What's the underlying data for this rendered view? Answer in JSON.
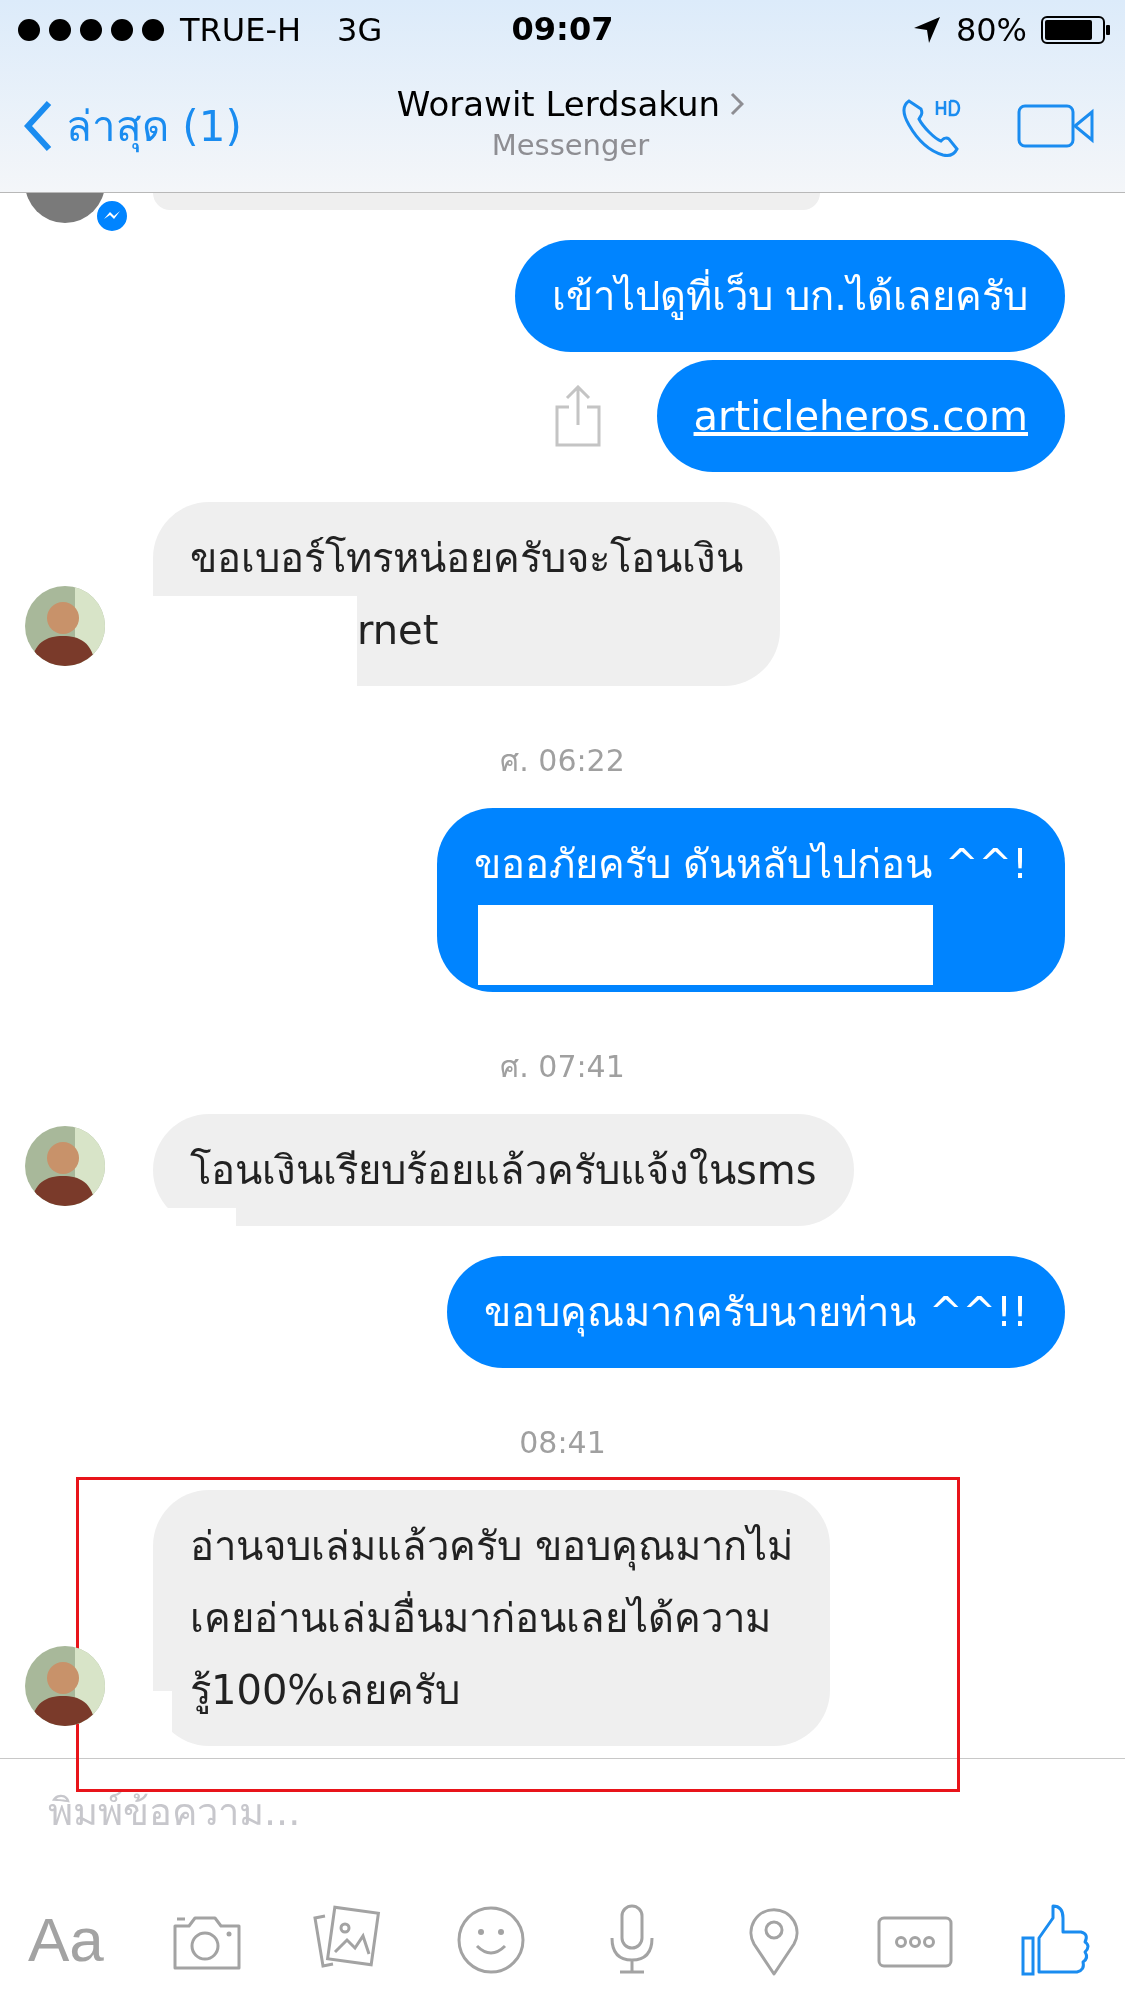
{
  "status_bar": {
    "carrier": "TRUE-H",
    "network": "3G",
    "time": "09:07",
    "battery": "80%"
  },
  "nav": {
    "back_label": "ล่าสุด (1)",
    "title": "Worawit Lerdsakun",
    "subtitle": "Messenger"
  },
  "messages": [
    {
      "kind": "partial"
    },
    {
      "kind": "outgoing",
      "lines": [
        "เข้าไปดูที่เว็บ บก.ได้เลยครับ"
      ]
    },
    {
      "kind": "link",
      "lines": [
        "articleheros.com"
      ]
    },
    {
      "kind": "incoming",
      "lines": [
        "ขอเบอร์โทรหน่อยครับจะโอนเงิน",
        "rnet"
      ],
      "redacted": true
    },
    {
      "kind": "timestamp",
      "text": "ศ. 06:22"
    },
    {
      "kind": "outgoing",
      "lines": [
        "ขออภัยครับ ดันหลับไปก่อน ^^!"
      ],
      "redacted": true
    },
    {
      "kind": "timestamp",
      "text": "ศ. 07:41"
    },
    {
      "kind": "incoming",
      "lines": [
        "โอนเงินเรียบร้อยแล้วครับแจ้งในsms"
      ],
      "redacted": true
    },
    {
      "kind": "outgoing",
      "lines": [
        "ขอบคุณมากครับนายท่าน ^^!!"
      ]
    },
    {
      "kind": "timestamp",
      "text": "08:41"
    },
    {
      "kind": "incoming",
      "lines": [
        "อ่านจบเล่มแล้วครับ ขอบคุณมากไม่",
        "เคยอ่านเล่มอื่นมาก่อนเลยได้ความ",
        "รู้100%เลยครับ"
      ],
      "redacted": true,
      "highlighted": true
    }
  ],
  "composer": {
    "placeholder": "พิมพ์ข้อความ..."
  },
  "toolbar": {
    "text_button": "Aa"
  }
}
